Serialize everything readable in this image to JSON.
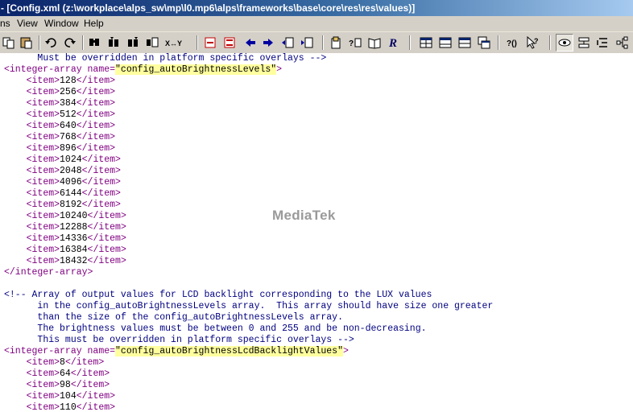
{
  "window": {
    "title": "- [Config.xml (z:\\workplace\\alps_sw\\mp\\l0.mp6\\alps\\frameworks\\base\\core\\res\\res\\values)]"
  },
  "menu": {
    "items": [
      "ns",
      "View",
      "Window",
      "Help"
    ]
  },
  "toolbar": {
    "buttons": [
      "copy-icon",
      "paste-icon",
      "undo-icon",
      "redo-icon",
      "find-icon",
      "find-next-icon",
      "find-prev-icon",
      "replace-icon",
      "swap-xy-icon",
      "bookmark-toggle-icon",
      "bookmark-clear-icon",
      "arrow-left-icon",
      "arrow-right-icon",
      "outdent-icon",
      "indent-icon",
      "open-file-icon",
      "format-icon",
      "book-icon",
      "script-r-icon",
      "window-tile-icon",
      "window-split-h-icon",
      "window-split-v-icon",
      "window-cascade-icon",
      "help-context-icon",
      "help-pointer-icon",
      "eye-icon",
      "tree-view-icon",
      "outline-icon",
      "hierarchy-icon"
    ]
  },
  "editor": {
    "lines": [
      {
        "indent": "      ",
        "comment": "Must be overridden in platform specific overlays -->"
      },
      {
        "indent": "",
        "open": "<integer-array name=",
        "value": "\"config_autoBrightnessLevels\"",
        "close": ">"
      },
      {
        "indent": "    ",
        "item": "128"
      },
      {
        "indent": "    ",
        "item": "256"
      },
      {
        "indent": "    ",
        "item": "384"
      },
      {
        "indent": "    ",
        "item": "512"
      },
      {
        "indent": "    ",
        "item": "640"
      },
      {
        "indent": "    ",
        "item": "768"
      },
      {
        "indent": "    ",
        "item": "896"
      },
      {
        "indent": "    ",
        "item": "1024"
      },
      {
        "indent": "    ",
        "item": "2048"
      },
      {
        "indent": "    ",
        "item": "4096"
      },
      {
        "indent": "    ",
        "item": "6144"
      },
      {
        "indent": "    ",
        "item": "8192"
      },
      {
        "indent": "    ",
        "item": "10240"
      },
      {
        "indent": "    ",
        "item": "12288"
      },
      {
        "indent": "    ",
        "item": "14336"
      },
      {
        "indent": "    ",
        "item": "16384"
      },
      {
        "indent": "    ",
        "item": "18432"
      },
      {
        "indent": "",
        "close_tag": "</integer-array>"
      },
      {
        "indent": "",
        "blank": true
      },
      {
        "indent": "",
        "comment": "<!-- Array of output values for LCD backlight corresponding to the LUX values"
      },
      {
        "indent": "      ",
        "comment": "in the config_autoBrightnessLevels array.  This array should have size one greater"
      },
      {
        "indent": "      ",
        "comment": "than the size of the config_autoBrightnessLevels array."
      },
      {
        "indent": "      ",
        "comment": "The brightness values must be between 0 and 255 and be non-decreasing."
      },
      {
        "indent": "      ",
        "comment": "This must be overridden in platform specific overlays -->"
      },
      {
        "indent": "",
        "open": "<integer-array name=",
        "value": "\"config_autoBrightnessLcdBacklightValues\"",
        "close": ">"
      },
      {
        "indent": "    ",
        "item": "8"
      },
      {
        "indent": "    ",
        "item": "64"
      },
      {
        "indent": "    ",
        "item": "98"
      },
      {
        "indent": "    ",
        "item": "104"
      },
      {
        "indent": "    ",
        "item": "110"
      }
    ],
    "item_open": "<item>",
    "item_close": "</item>"
  },
  "watermark": "MediaTek"
}
